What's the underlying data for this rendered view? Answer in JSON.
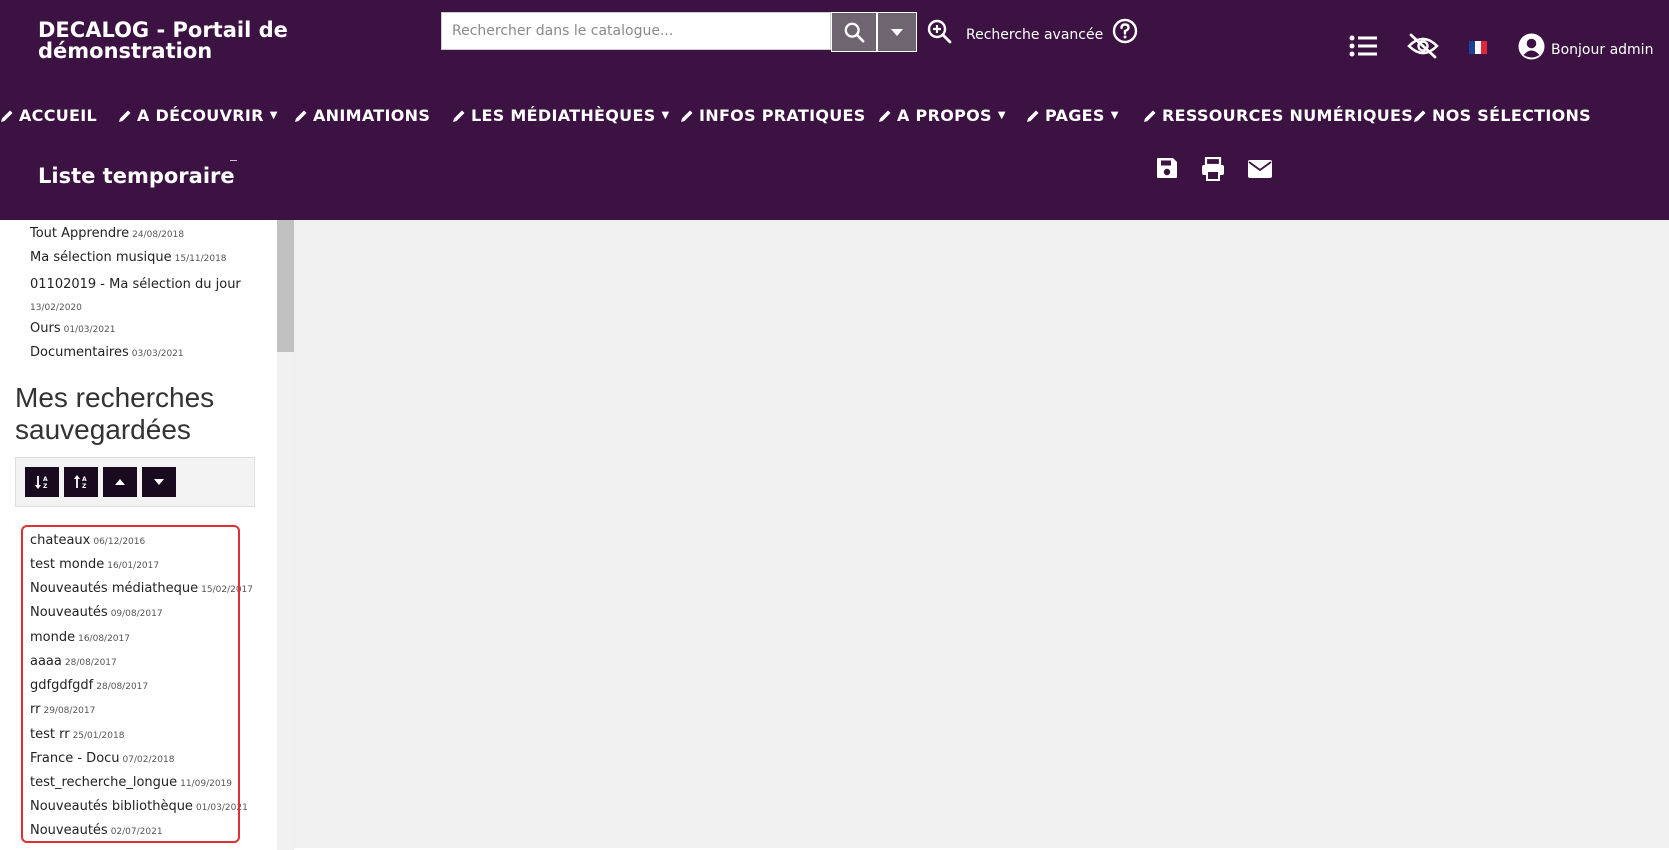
{
  "header": {
    "site_title_line1": "DECALOG - Portail de",
    "site_title_line2": "démonstration",
    "search_placeholder": "Rechercher dans le catalogue...",
    "advanced_search": "Recherche avancée",
    "user_greeting": "Bonjour admin",
    "colors": {
      "header_bg": "#3c1242",
      "search_btn": "#6f6570"
    }
  },
  "nav": {
    "items": [
      {
        "label": "ACCUEIL",
        "dropdown": false
      },
      {
        "label": "A DÉCOUVRIR",
        "dropdown": true
      },
      {
        "label": "ANIMATIONS",
        "dropdown": false
      },
      {
        "label": "LES MÉDIATHÈQUES",
        "dropdown": true
      },
      {
        "label": "INFOS PRATIQUES",
        "dropdown": false
      },
      {
        "label": "A PROPOS",
        "dropdown": true
      },
      {
        "label": "PAGES",
        "dropdown": true
      },
      {
        "label": "RESSOURCES NUMÉRIQUES",
        "dropdown": false
      },
      {
        "label": "NOS SÉLECTIONS",
        "dropdown": false
      }
    ]
  },
  "temp_list": {
    "title": "Liste temporaire"
  },
  "selections": [
    {
      "name": "Tout Apprendre",
      "date": "24/08/2018"
    },
    {
      "name": "Ma sélection musique",
      "date": "15/11/2018"
    },
    {
      "name": "01102019 - Ma sélection du jour",
      "date": "13/02/2020"
    },
    {
      "name": "Ours",
      "date": "01/03/2021"
    },
    {
      "name": "Documentaires",
      "date": "03/03/2021"
    }
  ],
  "saved_searches": {
    "heading": "Mes recherches sauvegardées",
    "items": [
      {
        "name": "chateaux",
        "date": "06/12/2016"
      },
      {
        "name": "test monde",
        "date": "16/01/2017"
      },
      {
        "name": "Nouveautés médiatheque",
        "date": "15/02/2017"
      },
      {
        "name": "Nouveautés",
        "date": "09/08/2017"
      },
      {
        "name": "monde",
        "date": "16/08/2017"
      },
      {
        "name": "aaaa",
        "date": "28/08/2017"
      },
      {
        "name": "gdfgdfgdf",
        "date": "28/08/2017"
      },
      {
        "name": "rr",
        "date": "29/08/2017"
      },
      {
        "name": "test rr",
        "date": "25/01/2018"
      },
      {
        "name": "France - Docu",
        "date": "07/02/2018"
      },
      {
        "name": "test_recherche_longue",
        "date": "11/09/2019"
      },
      {
        "name": "Nouveautés bibliothèque",
        "date": "01/03/2021"
      },
      {
        "name": "Nouveautés",
        "date": "02/07/2021"
      }
    ]
  },
  "icons": [
    "search-icon",
    "caret-down-icon",
    "zoom-in-icon",
    "help-icon",
    "list-icon",
    "eye-slash-icon",
    "flag-fr-icon",
    "user-icon",
    "pencil-icon",
    "save-icon",
    "print-icon",
    "email-icon",
    "sort-alpha-down-icon",
    "sort-alpha-up-icon",
    "caret-up-icon"
  ]
}
